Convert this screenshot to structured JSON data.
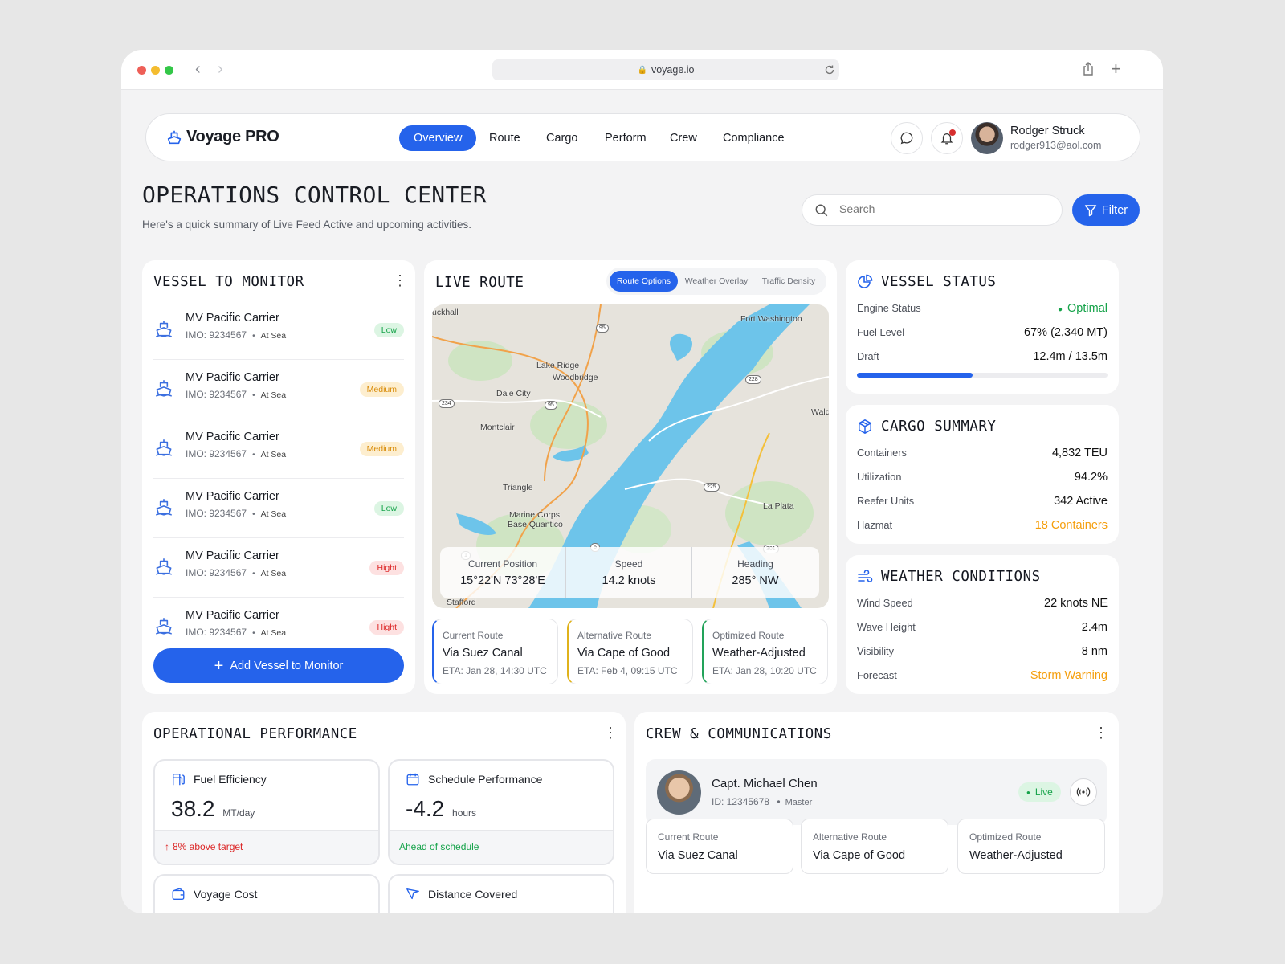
{
  "browser": {
    "url": "voyage.io"
  },
  "brand": "Voyage PRO",
  "nav_tabs": [
    "Overview",
    "Route",
    "Cargo",
    "Perform",
    "Crew",
    "Compliance"
  ],
  "user": {
    "name": "Rodger Struck",
    "email": "rodger913@aol.com"
  },
  "page": {
    "title": "OPERATIONS CONTROL CENTER",
    "subtitle": "Here's a quick summary of Live Feed Active and upcoming activities."
  },
  "search": {
    "placeholder": "Search"
  },
  "filter_label": "Filter",
  "vessels": {
    "title": "VESSEL TO MONITOR",
    "items": [
      {
        "name": "MV Pacific Carrier",
        "imo": "IMO: 9234567",
        "status": "At Sea",
        "risk": "Low"
      },
      {
        "name": "MV Pacific Carrier",
        "imo": "IMO: 9234567",
        "status": "At Sea",
        "risk": "Medium"
      },
      {
        "name": "MV Pacific Carrier",
        "imo": "IMO: 9234567",
        "status": "At Sea",
        "risk": "Medium"
      },
      {
        "name": "MV Pacific Carrier",
        "imo": "IMO: 9234567",
        "status": "At Sea",
        "risk": "Low"
      },
      {
        "name": "MV Pacific Carrier",
        "imo": "IMO: 9234567",
        "status": "At Sea",
        "risk": "Hight"
      },
      {
        "name": "MV Pacific Carrier",
        "imo": "IMO: 9234567",
        "status": "At Sea",
        "risk": "Hight"
      }
    ],
    "add_label": "Add Vessel to Monitor"
  },
  "live_route": {
    "title": "LIVE ROUTE",
    "toggles": [
      "Route Options",
      "Weather Overlay",
      "Traffic Density"
    ],
    "map_labels": [
      "uckhall",
      "Fort Washington",
      "Lake Ridge",
      "Woodbridge",
      "Dale City",
      "Montclair",
      "Triangle",
      "Marine Corps",
      "Base Quantico",
      "La Plata",
      "Wald",
      "Stafford"
    ],
    "road_labels": [
      "95",
      "228",
      "234",
      "225",
      "95",
      "6",
      "301",
      "1"
    ],
    "stats": [
      {
        "label": "Current Position",
        "value": "15°22'N 73°28'E"
      },
      {
        "label": "Speed",
        "value": "14.2 knots"
      },
      {
        "label": "Heading",
        "value": "285° NW"
      }
    ],
    "routes": [
      {
        "label": "Current Route",
        "name": "Via Suez Canal",
        "eta": "ETA: Jan 28, 14:30 UTC",
        "color": "#2563eb"
      },
      {
        "label": "Alternative Route",
        "name": "Via Cape of Good",
        "eta": "ETA: Feb 4, 09:15 UTC",
        "color": "#e0b21b"
      },
      {
        "label": "Optimized Route",
        "name": "Weather-Adjusted",
        "eta": "ETA: Jan 28, 10:20 UTC",
        "color": "#22a35a"
      }
    ]
  },
  "vessel_status": {
    "title": "VESSEL STATUS",
    "rows": [
      {
        "label": "Engine Status",
        "value": "Optimal"
      },
      {
        "label": "Fuel Level",
        "value": "67% (2,340 MT)"
      },
      {
        "label": "Draft",
        "value": "12.4m / 13.5m"
      }
    ],
    "progress": 0.46
  },
  "cargo": {
    "title": "CARGO SUMMARY",
    "rows": [
      {
        "label": "Containers",
        "value": "4,832 TEU"
      },
      {
        "label": "Utilization",
        "value": "94.2%"
      },
      {
        "label": "Reefer Units",
        "value": "342 Active"
      },
      {
        "label": "Hazmat",
        "value": "18 Containers"
      }
    ]
  },
  "weather": {
    "title": "WEATHER CONDITIONS",
    "rows": [
      {
        "label": "Wind Speed",
        "value": "22 knots NE"
      },
      {
        "label": "Wave Height",
        "value": "2.4m"
      },
      {
        "label": "Visibility",
        "value": "8 nm"
      },
      {
        "label": "Forecast",
        "value": "Storm Warning"
      }
    ]
  },
  "performance": {
    "title": "OPERATIONAL PERFORMANCE",
    "boxes": [
      {
        "title": "Fuel Efficiency",
        "value": "38.2",
        "unit": "MT/day",
        "note": "8% above target"
      },
      {
        "title": "Schedule Performance",
        "value": "-4.2",
        "unit": "hours",
        "note": "Ahead of schedule"
      },
      {
        "title": "Voyage Cost"
      },
      {
        "title": "Distance Covered"
      }
    ]
  },
  "crew": {
    "title": "CREW & COMMUNICATIONS",
    "captain": {
      "name": "Capt. Michael Chen",
      "id": "ID: 12345678",
      "role": "Master",
      "status": "Live"
    },
    "routes": [
      {
        "label": "Current Route",
        "name": "Via Suez Canal"
      },
      {
        "label": "Alternative Route",
        "name": "Via Cape of Good"
      },
      {
        "label": "Optimized Route",
        "name": "Weather-Adjusted"
      }
    ]
  },
  "colors": {
    "accent": "#2563eb",
    "optimal": "#16a34a",
    "warning": "#f59e0b",
    "danger": "#dc2626"
  }
}
